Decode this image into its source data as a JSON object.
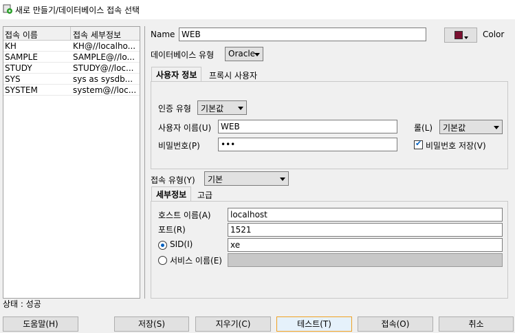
{
  "window": {
    "title": "새로 만들기/데이터베이스 접속 선택"
  },
  "connections": {
    "headers": [
      "접속 이름",
      "접속 세부정보"
    ],
    "rows": [
      {
        "name": "KH",
        "detail": "KH@//localho..."
      },
      {
        "name": "SAMPLE",
        "detail": "SAMPLE@//lo..."
      },
      {
        "name": "STUDY",
        "detail": "STUDY@//loc..."
      },
      {
        "name": "SYS",
        "detail": "sys as sysdb..."
      },
      {
        "name": "SYSTEM",
        "detail": "system@//loc..."
      }
    ]
  },
  "form": {
    "name_label": "Name",
    "name_value": "WEB",
    "color_label": "Color",
    "color_swatch": "#7a1030",
    "db_type_label": "데이터베이스 유형",
    "db_type_value": "Oracle",
    "tabs_user": [
      {
        "label": "사용자 정보"
      },
      {
        "label": "프록시 사용자"
      }
    ],
    "auth_type_label": "인증 유형",
    "auth_type_value": "기본값",
    "username_label": "사용자 이름(U)",
    "username_value": "WEB",
    "role_label": "롤(L)",
    "role_value": "기본값",
    "password_label": "비밀번호(P)",
    "password_value": "•••",
    "save_password_label": "비밀번호 저장(V)",
    "save_password_checked": true,
    "conn_type_label": "접속 유형(Y)",
    "conn_type_value": "기본",
    "tabs_detail": [
      {
        "label": "세부정보"
      },
      {
        "label": "고급"
      }
    ],
    "host_label": "호스트 이름(A)",
    "host_value": "localhost",
    "port_label": "포트(R)",
    "port_value": "1521",
    "sid_label": "SID(I)",
    "sid_value": "xe",
    "sid_selected": true,
    "service_label": "서비스 이름(E)",
    "service_value": ""
  },
  "status": {
    "text": "상태 : 성공"
  },
  "buttons": {
    "help": "도움말(H)",
    "save": "저장(S)",
    "clear": "지우기(C)",
    "test": "테스트(T)",
    "connect": "접속(O)",
    "cancel": "취소"
  }
}
